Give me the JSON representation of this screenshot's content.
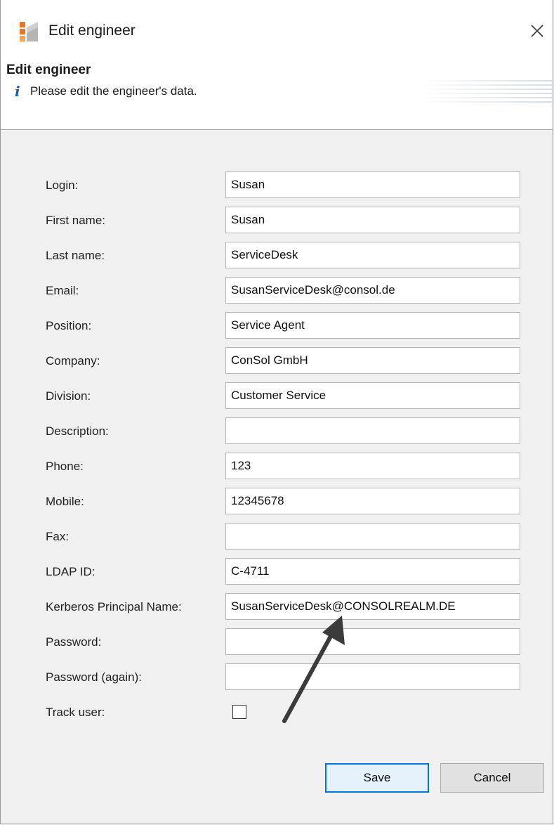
{
  "window": {
    "title": "Edit engineer",
    "header_title": "Edit engineer",
    "header_subtitle": "Please edit the engineer's data.",
    "info_glyph": "i"
  },
  "form": {
    "fields": [
      {
        "label": "Login:",
        "value": "Susan",
        "type": "text"
      },
      {
        "label": "First name:",
        "value": "Susan",
        "type": "text"
      },
      {
        "label": "Last name:",
        "value": "ServiceDesk",
        "type": "text"
      },
      {
        "label": "Email:",
        "value": "SusanServiceDesk@consol.de",
        "type": "text"
      },
      {
        "label": "Position:",
        "value": "Service Agent",
        "type": "text"
      },
      {
        "label": "Company:",
        "value": "ConSol GmbH",
        "type": "text"
      },
      {
        "label": "Division:",
        "value": "Customer Service",
        "type": "text"
      },
      {
        "label": "Description:",
        "value": "",
        "type": "text"
      },
      {
        "label": "Phone:",
        "value": "123",
        "type": "text"
      },
      {
        "label": "Mobile:",
        "value": "12345678",
        "type": "text"
      },
      {
        "label": "Fax:",
        "value": "",
        "type": "text"
      },
      {
        "label": "LDAP ID:",
        "value": "C-4711",
        "type": "text"
      },
      {
        "label": "Kerberos Principal Name:",
        "value": "SusanServiceDesk@CONSOLREALM.DE",
        "type": "text"
      },
      {
        "label": "Password:",
        "value": "",
        "type": "password"
      },
      {
        "label": "Password (again):",
        "value": "",
        "type": "password"
      }
    ],
    "track_user": {
      "label": "Track user:",
      "checked": false
    }
  },
  "buttons": {
    "save": "Save",
    "cancel": "Cancel"
  },
  "colors": {
    "accent": "#0078d7",
    "info_icon": "#1a5fb4",
    "app_icon_orange": "#e87722"
  },
  "icons": {
    "app": "consol-app-icon",
    "close": "close-icon",
    "info": "info-icon",
    "checkbox": "checkbox-unchecked",
    "annotation": "arrow-annotation"
  }
}
